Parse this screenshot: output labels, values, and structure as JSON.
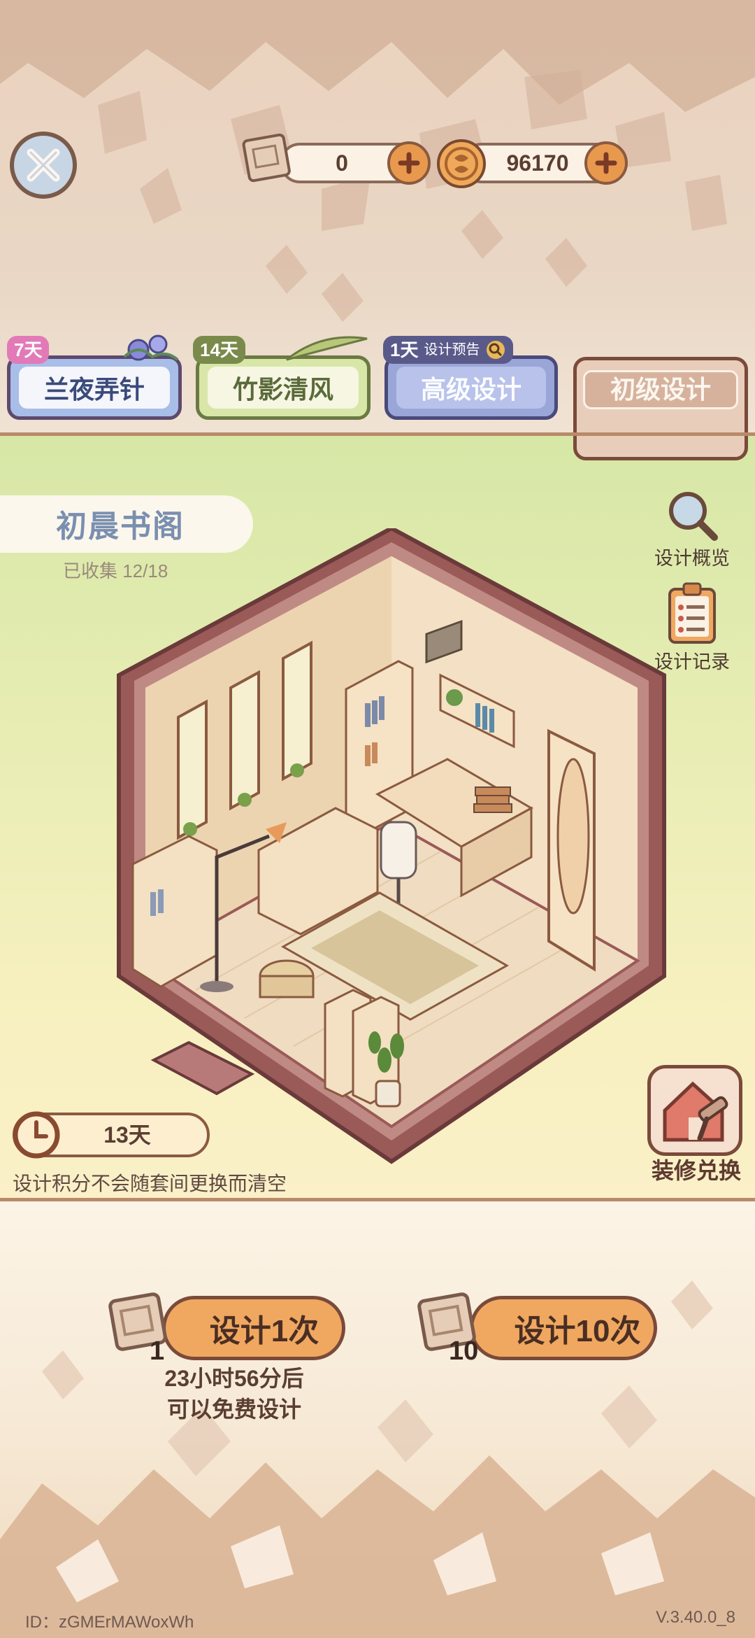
{
  "header": {
    "currencies": [
      {
        "icon": "blueprint-scroll-icon",
        "value": "0"
      },
      {
        "icon": "coin-icon",
        "value": "96170"
      }
    ]
  },
  "tabs": [
    {
      "label": "兰夜弄针",
      "badge": "7天",
      "color": "#a8bde8",
      "badge_color": "#e27ab8",
      "active": false
    },
    {
      "label": "竹影清风",
      "badge": "14天",
      "color": "#d8e6a8",
      "badge_color": "#7a8a4a",
      "active": false
    },
    {
      "label": "高级设计",
      "badge": "1天",
      "badge_extra": "设计预告",
      "color": "#9aa6d8",
      "badge_color": "#5a5a8a",
      "active": false
    },
    {
      "label": "初级设计",
      "color": "#e8cdbb",
      "active": true
    }
  ],
  "room": {
    "name": "初晨书阁",
    "collected": "已收集 12/18"
  },
  "side_buttons": {
    "overview": "设计概览",
    "records": "设计记录"
  },
  "timer": {
    "value": "13天"
  },
  "notice": "设计积分不会随套间更换而清空",
  "renovate": {
    "label": "装修兑换"
  },
  "design": {
    "once": {
      "label": "设计1次",
      "cost": "1"
    },
    "ten": {
      "label": "设计10次",
      "cost": "10"
    },
    "free_hint_line1": "23小时56分后",
    "free_hint_line2": "可以免费设计"
  },
  "footer": {
    "id": "ID：zGMErMAWoxWh",
    "version": "V.3.40.0_8"
  }
}
